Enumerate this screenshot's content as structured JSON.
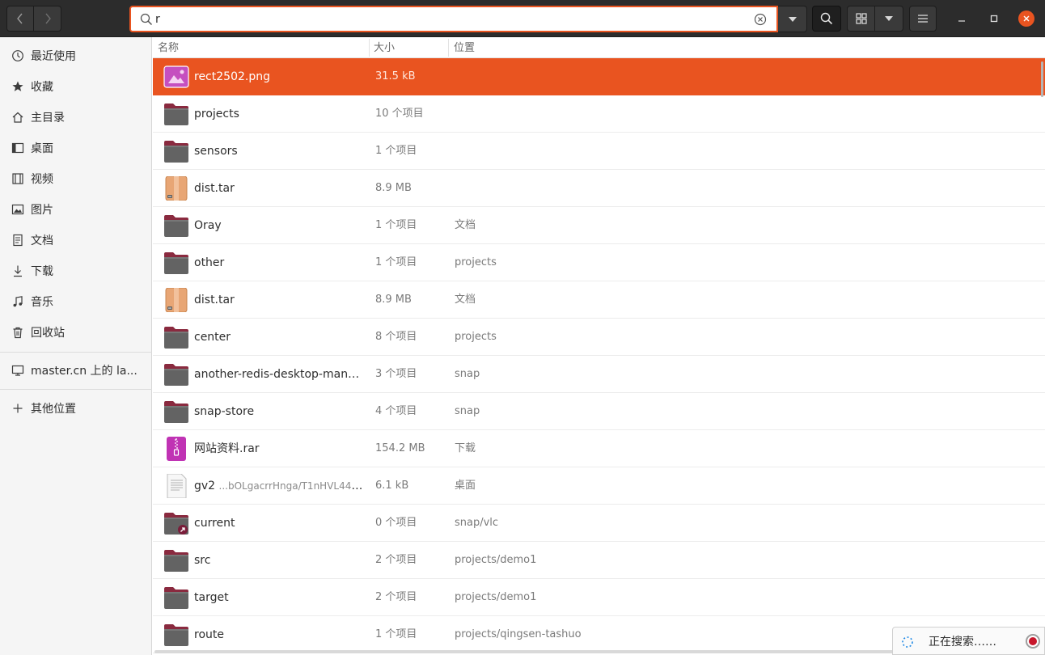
{
  "colors": {
    "accent": "#e95420",
    "header": "#2c2c2c",
    "sidebar": "#f5f5f5",
    "folder": "#636363",
    "folder_tab": "#8a2a3f"
  },
  "search": {
    "value": "r"
  },
  "sidebar": {
    "items": [
      {
        "label": "最近使用",
        "icon": "clock-icon"
      },
      {
        "label": "收藏",
        "icon": "star-icon"
      },
      {
        "label": "主目录",
        "icon": "home-icon"
      },
      {
        "label": "桌面",
        "icon": "desktop-icon"
      },
      {
        "label": "视频",
        "icon": "video-icon"
      },
      {
        "label": "图片",
        "icon": "image-icon"
      },
      {
        "label": "文档",
        "icon": "document-icon"
      },
      {
        "label": "下载",
        "icon": "download-icon"
      },
      {
        "label": "音乐",
        "icon": "music-icon"
      },
      {
        "label": "回收站",
        "icon": "trash-icon"
      }
    ],
    "network": {
      "label": "master.cn 上的 la...",
      "icon": "network-drive-icon"
    },
    "other": {
      "label": "其他位置",
      "icon": "plus-icon"
    }
  },
  "columns": {
    "name": "名称",
    "size": "大小",
    "location": "位置"
  },
  "files": [
    {
      "name": "rect2502.png",
      "size": "31.5 kB",
      "location": "",
      "type": "image",
      "selected": true
    },
    {
      "name": "projects",
      "size": "10 个项目",
      "location": "",
      "type": "folder"
    },
    {
      "name": "sensors",
      "size": "1 个项目",
      "location": "",
      "type": "folder"
    },
    {
      "name": "dist.tar",
      "size": "8.9 MB",
      "location": "",
      "type": "archive"
    },
    {
      "name": "Oray",
      "size": "1 个项目",
      "location": "文档",
      "type": "folder"
    },
    {
      "name": "other",
      "size": "1 个项目",
      "location": "projects",
      "type": "folder"
    },
    {
      "name": "dist.tar",
      "size": "8.9 MB",
      "location": "文档",
      "type": "archive"
    },
    {
      "name": "center",
      "size": "8 个项目",
      "location": "projects",
      "type": "folder"
    },
    {
      "name": "another-redis-desktop-mana...",
      "size": "3 个项目",
      "location": "snap",
      "type": "folder"
    },
    {
      "name": "snap-store",
      "size": "4 个项目",
      "location": "snap",
      "type": "folder"
    },
    {
      "name": "网站资料.rar",
      "size": "154.2 MB",
      "location": "下载",
      "type": "rar"
    },
    {
      "name": "gv2",
      "name_suffix": "...bOLgacrrHnga/T1nHVL44x...",
      "size": "6.1 kB",
      "location": "桌面",
      "type": "text"
    },
    {
      "name": "current",
      "size": "0 个项目",
      "location": "snap/vlc",
      "type": "folder-link"
    },
    {
      "name": "src",
      "size": "2 个项目",
      "location": "projects/demo1",
      "type": "folder"
    },
    {
      "name": "target",
      "size": "2 个项目",
      "location": "projects/demo1",
      "type": "folder"
    },
    {
      "name": "route",
      "size": "1 个项目",
      "location": "projects/qingsen-tashuo",
      "type": "folder"
    }
  ],
  "status": {
    "text": "正在搜索……"
  }
}
